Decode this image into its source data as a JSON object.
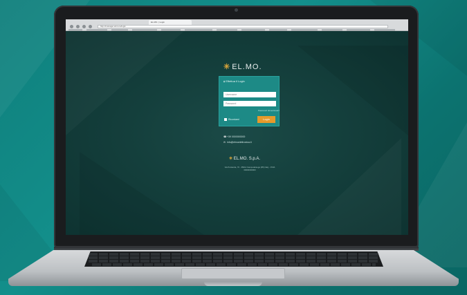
{
  "browser": {
    "tab_title": "EL.MO. | Login",
    "url": "http://manager.elmo.io/login"
  },
  "brand": {
    "logo_text": "EL.MO.",
    "accent_color": "#d8a43a",
    "theme_color": "#1d8a86"
  },
  "login": {
    "header": "Effettua il Login",
    "username_placeholder": "Username",
    "password_placeholder": "Password",
    "forgot_label": "Password dimenticata?",
    "remember_label": "Ricordami",
    "button_label": "Login"
  },
  "contact": {
    "phone": "+39 0000000000",
    "email": "info@elmoelettronica.it"
  },
  "footer": {
    "logo_text": "EL.MO. S.p.A.",
    "legal_text": "Via Pontarola, 70 - 35011 Campodarsego (PD) Italy - P.IVA 00000000000"
  }
}
